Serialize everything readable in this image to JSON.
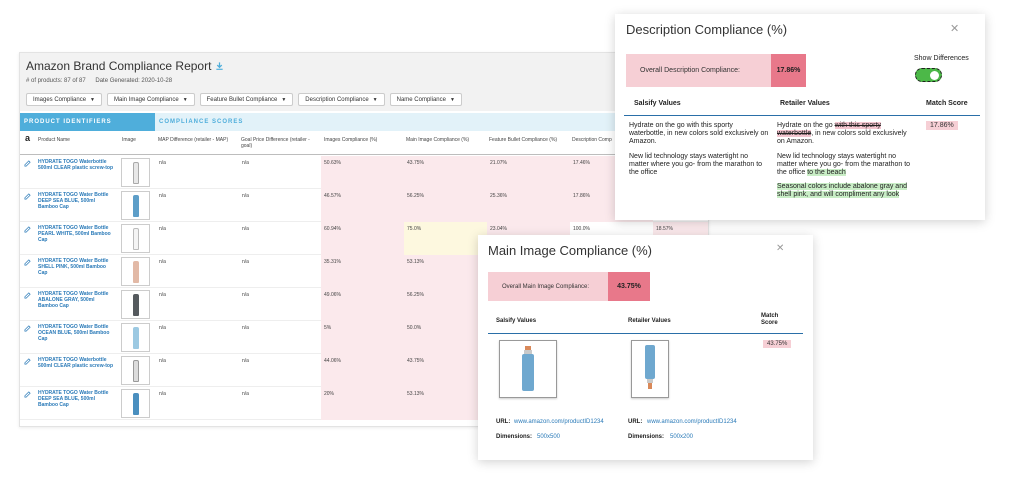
{
  "report": {
    "title": "Amazon Brand Compliance Report",
    "products_count": "# of products: 87 of 87",
    "date_generated": "Date Generated: 2020-10-28",
    "filters": [
      "Images Compliance",
      "Main Image Compliance",
      "Feature Bullet Compliance",
      "Description Compliance",
      "Name Compliance"
    ],
    "band_identifiers": "PRODUCT IDENTIFIERS",
    "band_scores": "COMPLIANCE SCORES",
    "columns": [
      "Product Name",
      "Image",
      "MAP Difference (retailer - MAP)",
      "Goal Price Difference (retailer - goal)",
      "Images Compliance (%)",
      "Main Image Compliance (%)",
      "Feature Bullet Compliance (%)",
      "Description Comp"
    ],
    "rows": [
      {
        "name": "HYDRATE TOGO Waterbottle 500ml CLEAR plastic screw-top",
        "bottle": "#e8e8e8",
        "map": "n/a",
        "goal": "n/a",
        "images": "50.63%",
        "main": "43.75%",
        "bullet": "21.07%",
        "desc": "17.46%"
      },
      {
        "name": "HYDRATE TOGO Water Bottle DEEP SEA BLUE, 500ml Bamboo Cap",
        "bottle": "#5d9ec8",
        "map": "n/a",
        "goal": "n/a",
        "images": "46.57%",
        "main": "56.25%",
        "bullet": "25.36%",
        "desc": "17.86%"
      },
      {
        "name": "HYDRATE TOGO Water Bottle PEARL WHITE, 500ml Bamboo Cap",
        "bottle": "#f4f4f4",
        "map": "n/a",
        "goal": "n/a",
        "images": "60.94%",
        "main": "75.0%",
        "bullet": "23.04%",
        "desc": "100.0%",
        "extra": "18.57%"
      },
      {
        "name": "HYDRATE TOGO Water Bottle SHELL PINK, 500ml Bamboo Cap",
        "bottle": "#e2b9a6",
        "map": "n/a",
        "goal": "n/a",
        "images": "35.31%",
        "main": "53.13%",
        "bullet": "",
        "desc": ""
      },
      {
        "name": "HYDRATE TOGO Water Bottle ABALONE GRAY, 500ml Bamboo Cap",
        "bottle": "#555a5e",
        "map": "n/a",
        "goal": "n/a",
        "images": "49.06%",
        "main": "56.25%",
        "bullet": "",
        "desc": ""
      },
      {
        "name": "HYDRATE TOGO Water Bottle OCEAN BLUE, 500ml Bamboo Cap",
        "bottle": "#9cc9e2",
        "map": "n/a",
        "goal": "n/a",
        "images": "5%",
        "main": "50.0%",
        "bullet": "",
        "desc": ""
      },
      {
        "name": "HYDRATE TOGO Waterbottle 500ml CLEAR plastic screw-top",
        "bottle": "#dcdcdc",
        "map": "n/a",
        "goal": "n/a",
        "images": "44.06%",
        "main": "43.75%",
        "bullet": "",
        "desc": ""
      },
      {
        "name": "HYDRATE TOGO Water Bottle DEEP SEA BLUE, 500ml Bamboo Cap",
        "bottle": "#4a8fbf",
        "map": "n/a",
        "goal": "n/a",
        "images": "20%",
        "main": "53.13%",
        "bullet": "",
        "desc": ""
      }
    ]
  },
  "desc_modal": {
    "title": "Description Compliance (%)",
    "overall_label": "Overall Description Compliance:",
    "overall_value": "17.86%",
    "show_differences": "Show Differences",
    "col_salsify": "Salsify Values",
    "col_retailer": "Retailer Values",
    "col_score": "Match Score",
    "salsify_p1": "Hydrate on the go with this sporty waterbottle, in new colors sold exclusively on Amazon.",
    "salsify_p2": "New lid technology stays watertight no matter where you go- from the marathon to the office",
    "retailer_p1_a": "Hydrate on the go ",
    "retailer_p1_del": "with this sporty waterbottle",
    "retailer_p1_b": ", in new colors sold exclusively on Amazon.",
    "retailer_p2_a": "New lid technology stays watertight no matter where you go- from the marathon to the office ",
    "retailer_p2_ins": "to the beach",
    "retailer_p3_ins": "Seasonal colors include abalone gray and shell pink, and will compliment any look",
    "score": "17.86%"
  },
  "img_modal": {
    "title": "Main Image Compliance (%)",
    "overall_label": "Overall Main Image Compliance:",
    "overall_value": "43.75%",
    "col_salsify": "Salsify Values",
    "col_retailer": "Retailer Values",
    "col_score": "Match Score",
    "score": "43.75%",
    "url_label": "URL:",
    "salsify_url": "www.amazon.com/productID1234",
    "retailer_url": "www.amazon.com/productID1234",
    "dimensions_label": "Dimensions:",
    "salsify_dimensions": "500x500",
    "retailer_dimensions": "500x200"
  },
  "icons": {
    "close": "close-icon",
    "download": "download-icon",
    "edit": "edit-icon",
    "amazon": "amazon-icon"
  },
  "colors": {
    "accent": "#4faedb",
    "link": "#2a7ab8",
    "mismatch": "#fbe9ec",
    "warn": "#fdf8df",
    "score_badge": "#e8788a",
    "toggle_on": "#4cb848"
  }
}
